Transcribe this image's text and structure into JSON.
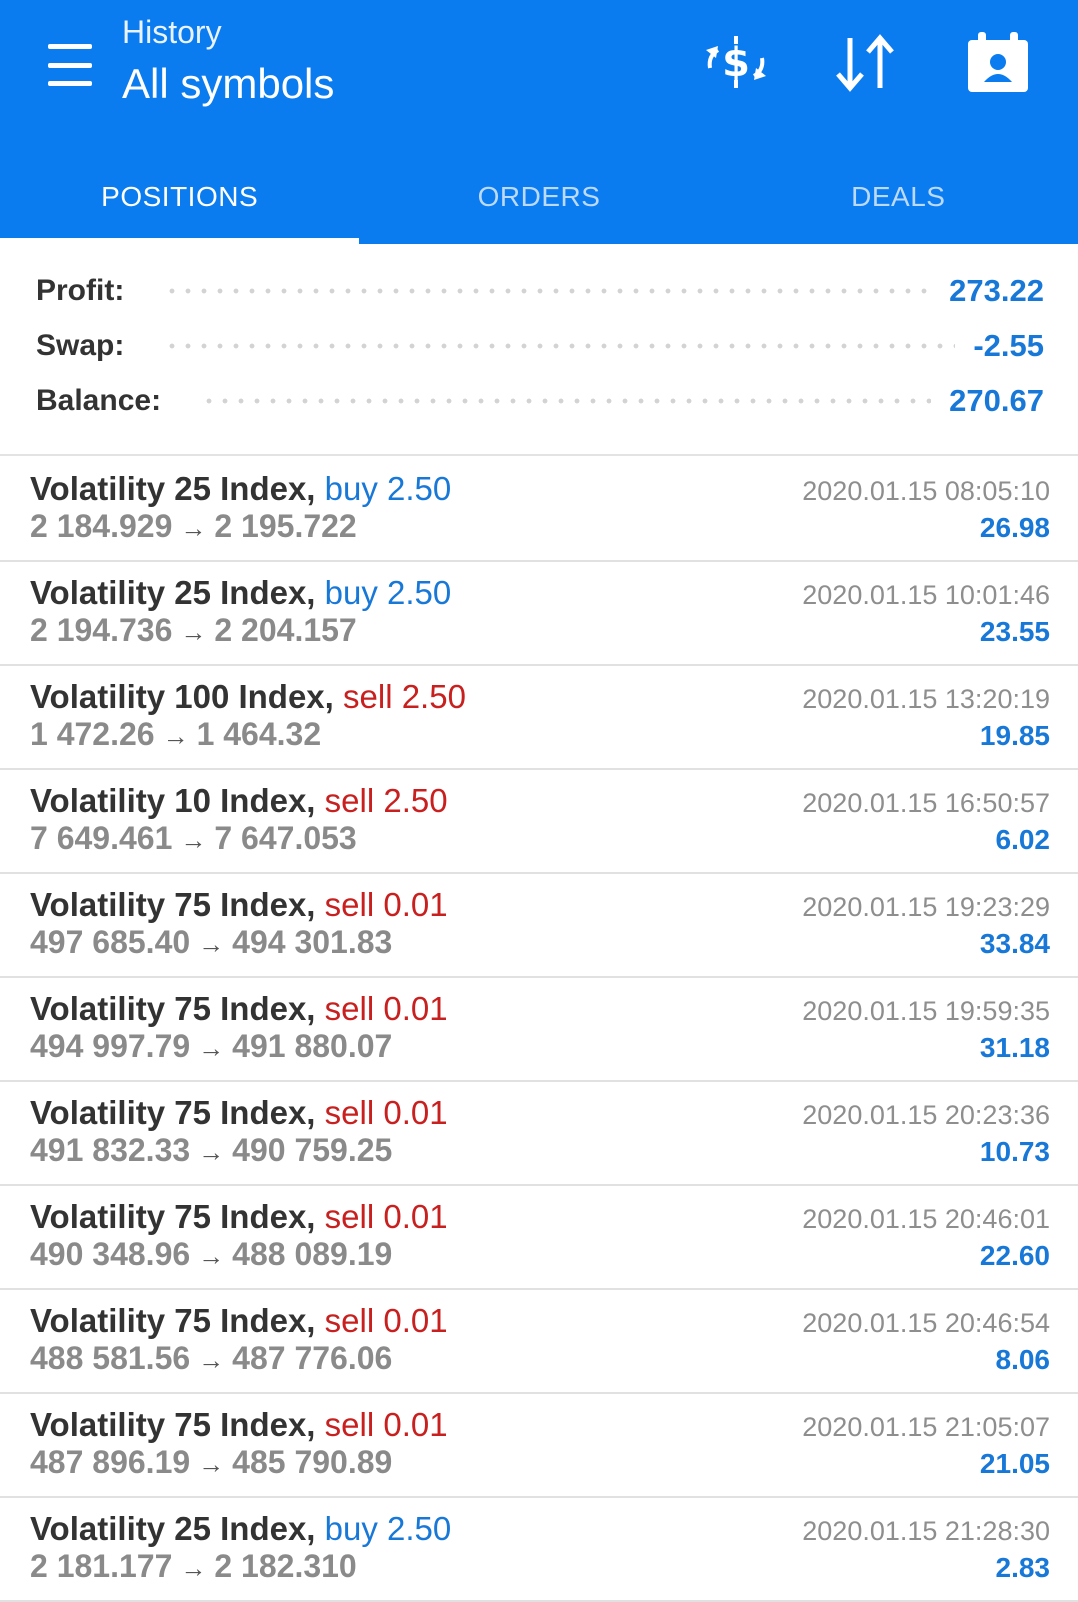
{
  "header": {
    "subtitle": "History",
    "title": "All symbols",
    "icons": [
      "currency-exchange-icon",
      "sort-icon",
      "calendar-icon"
    ]
  },
  "tabs": [
    {
      "label": "POSITIONS",
      "active": true
    },
    {
      "label": "ORDERS",
      "active": false
    },
    {
      "label": "DEALS",
      "active": false
    }
  ],
  "summary": {
    "profit_label": "Profit:",
    "profit_value": "273.22",
    "swap_label": "Swap:",
    "swap_value": "-2.55",
    "balance_label": "Balance:",
    "balance_value": "270.67"
  },
  "positions": [
    {
      "symbol": "Volatility 25 Index,",
      "direction": "buy",
      "volume": "buy 2.50",
      "open": "2 184.929",
      "close": "2 195.722",
      "time": "2020.01.15 08:05:10",
      "profit": "26.98"
    },
    {
      "symbol": "Volatility 25 Index,",
      "direction": "buy",
      "volume": "buy 2.50",
      "open": "2 194.736",
      "close": "2 204.157",
      "time": "2020.01.15 10:01:46",
      "profit": "23.55"
    },
    {
      "symbol": "Volatility 100 Index,",
      "direction": "sell",
      "volume": "sell 2.50",
      "open": "1 472.26",
      "close": "1 464.32",
      "time": "2020.01.15 13:20:19",
      "profit": "19.85"
    },
    {
      "symbol": "Volatility 10 Index,",
      "direction": "sell",
      "volume": "sell 2.50",
      "open": "7 649.461",
      "close": "7 647.053",
      "time": "2020.01.15 16:50:57",
      "profit": "6.02"
    },
    {
      "symbol": "Volatility 75 Index,",
      "direction": "sell",
      "volume": "sell 0.01",
      "open": "497 685.40",
      "close": "494 301.83",
      "time": "2020.01.15 19:23:29",
      "profit": "33.84"
    },
    {
      "symbol": "Volatility 75 Index,",
      "direction": "sell",
      "volume": "sell 0.01",
      "open": "494 997.79",
      "close": "491 880.07",
      "time": "2020.01.15 19:59:35",
      "profit": "31.18"
    },
    {
      "symbol": "Volatility 75 Index,",
      "direction": "sell",
      "volume": "sell 0.01",
      "open": "491 832.33",
      "close": "490 759.25",
      "time": "2020.01.15 20:23:36",
      "profit": "10.73"
    },
    {
      "symbol": "Volatility 75 Index,",
      "direction": "sell",
      "volume": "sell 0.01",
      "open": "490 348.96",
      "close": "488 089.19",
      "time": "2020.01.15 20:46:01",
      "profit": "22.60"
    },
    {
      "symbol": "Volatility 75 Index,",
      "direction": "sell",
      "volume": "sell 0.01",
      "open": "488 581.56",
      "close": "487 776.06",
      "time": "2020.01.15 20:46:54",
      "profit": "8.06"
    },
    {
      "symbol": "Volatility 75 Index,",
      "direction": "sell",
      "volume": "sell 0.01",
      "open": "487 896.19",
      "close": "485 790.89",
      "time": "2020.01.15 21:05:07",
      "profit": "21.05"
    },
    {
      "symbol": "Volatility 25 Index,",
      "direction": "buy",
      "volume": "buy 2.50",
      "open": "2 181.177",
      "close": "2 182.310",
      "time": "2020.01.15 21:28:30",
      "profit": "2.83"
    }
  ],
  "colors": {
    "header_bg": "#0a7cf0",
    "buy": "#1878d8",
    "sell": "#c8201f",
    "profit": "#1878d8"
  }
}
